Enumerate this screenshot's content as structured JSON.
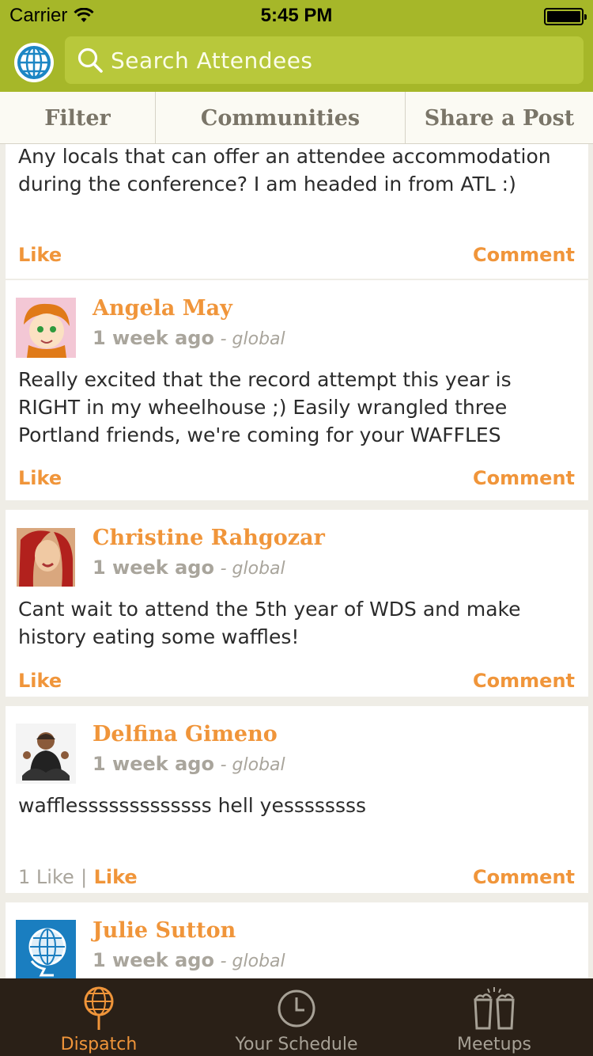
{
  "status": {
    "carrier": "Carrier",
    "time": "5:45 PM"
  },
  "search": {
    "placeholder": "Search Attendees"
  },
  "segments": [
    "Filter",
    "Communities",
    "Share a Post"
  ],
  "posts": [
    {
      "text": "Any locals that can offer an attendee accommodation during the conference? I am headed in from ATL :)",
      "like_label": "Like",
      "comment_label": "Comment"
    },
    {
      "author": "Angela May",
      "time": "1 week ago",
      "scope": "- global",
      "text": "Really excited that the record attempt this year is RIGHT in my wheelhouse ;) Easily wrangled three Portland friends, we're coming for your WAFFLES",
      "like_label": "Like",
      "comment_label": "Comment"
    },
    {
      "author": "Christine Rahgozar",
      "time": "1 week ago",
      "scope": "- global",
      "text": "Cant wait to attend the 5th year of WDS and make history eating some waffles!",
      "like_label": "Like",
      "comment_label": "Comment"
    },
    {
      "author": "Delfina Gimeno",
      "time": "1 week ago",
      "scope": "- global",
      "text": "wafflesssssssssssss hell yessssssss",
      "like_count": "1 Like",
      "like_sep": "|",
      "like_label": "Like",
      "comment_label": "Comment"
    },
    {
      "author": "Julie Sutton",
      "time": "1 week ago",
      "scope": "- global"
    }
  ],
  "tabs": [
    {
      "label": "Dispatch",
      "icon": "racket-globe-icon",
      "active": true
    },
    {
      "label": "Your Schedule",
      "icon": "clock-icon",
      "active": false
    },
    {
      "label": "Meetups",
      "icon": "cheers-icon",
      "active": false
    }
  ],
  "colors": {
    "header": "#a6b729",
    "accent": "#f0953a",
    "tabbar": "#2a2017"
  }
}
